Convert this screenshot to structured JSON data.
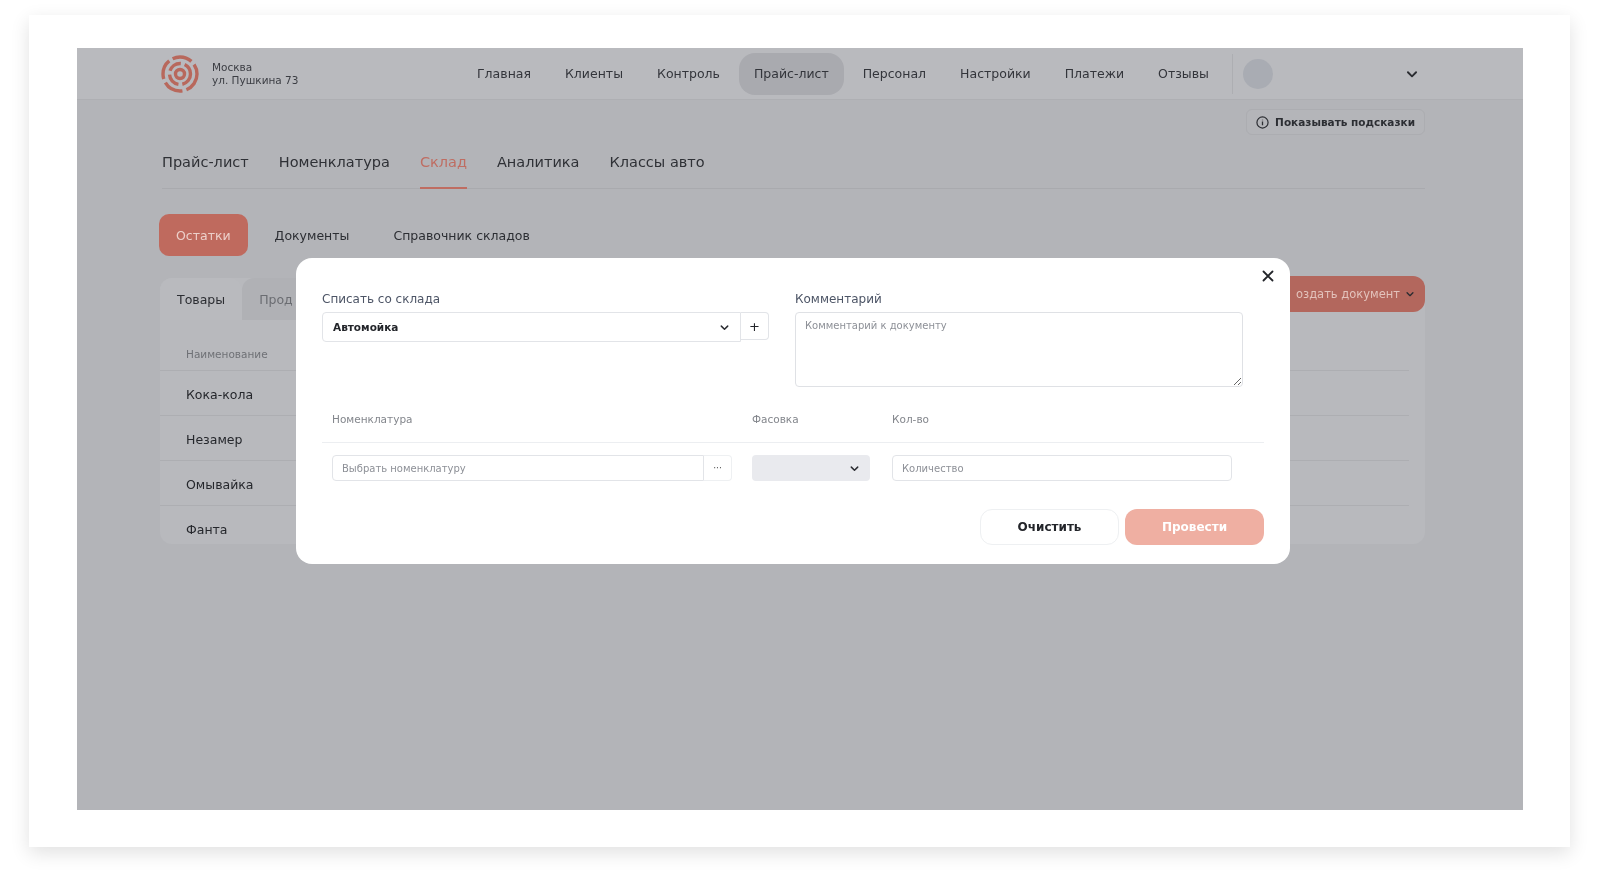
{
  "header": {
    "city": "Москва",
    "address": "ул. Пушкина 73",
    "nav": [
      {
        "label": "Главная",
        "selected": false
      },
      {
        "label": "Клиенты",
        "selected": false
      },
      {
        "label": "Контроль",
        "selected": false
      },
      {
        "label": "Прайс-лист",
        "selected": true
      },
      {
        "label": "Персонал",
        "selected": false
      },
      {
        "label": "Настройки",
        "selected": false
      },
      {
        "label": "Платежи",
        "selected": false
      },
      {
        "label": "Отзывы",
        "selected": false
      }
    ]
  },
  "hints_button": "Показывать подсказки",
  "tabs": [
    {
      "label": "Прайс-лист",
      "selected": false
    },
    {
      "label": "Номенклатура",
      "selected": false
    },
    {
      "label": "Склад",
      "selected": true
    },
    {
      "label": "Аналитика",
      "selected": false
    },
    {
      "label": "Классы авто",
      "selected": false
    }
  ],
  "subtabs": [
    {
      "label": "Остатки",
      "selected": true
    },
    {
      "label": "Документы",
      "selected": false
    },
    {
      "label": "Справочник складов",
      "selected": false
    }
  ],
  "card": {
    "tabs": [
      {
        "label": "Товары",
        "selected": true
      },
      {
        "label": "Прод",
        "selected": false
      }
    ],
    "create_button": "оздать документ",
    "column": "Наименование",
    "rows": [
      "Кока-кола",
      "Незамер",
      "Омывайка",
      "Фанта"
    ]
  },
  "modal": {
    "warehouse_label": "Списать со склада",
    "warehouse_value": "Автомойка",
    "add_button": "+",
    "comment_label": "Комментарий",
    "comment_placeholder": "Комментарий к документу",
    "columns": [
      "Номенклатура",
      "Фасовка",
      "Кол-во"
    ],
    "nomenclature_placeholder": "Выбрать номенклатуру",
    "more_button": "···",
    "quantity_placeholder": "Количество",
    "clear_button": "Очистить",
    "submit_button": "Провести",
    "submit_disabled": true
  }
}
